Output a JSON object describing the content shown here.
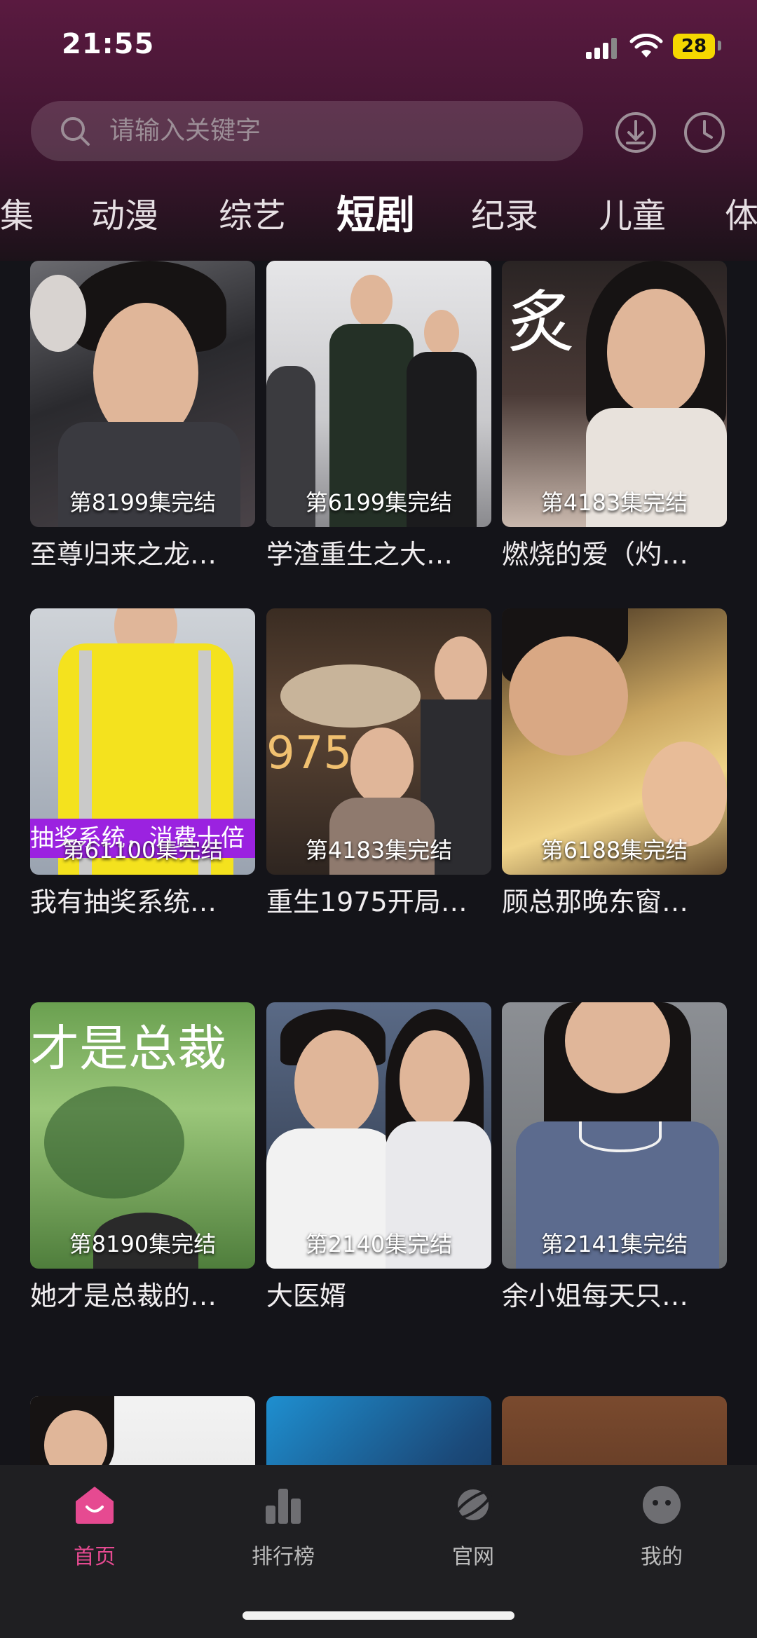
{
  "status_bar": {
    "time": "21:55",
    "battery": "28"
  },
  "search": {
    "placeholder": "请输入关键字"
  },
  "tabs": [
    {
      "label": "集"
    },
    {
      "label": "动漫"
    },
    {
      "label": "综艺"
    },
    {
      "label": "短剧",
      "active": true
    },
    {
      "label": "纪录"
    },
    {
      "label": "儿童"
    },
    {
      "label": "体"
    }
  ],
  "items": [
    {
      "episodes": "第8199集完结",
      "title": "至尊归来之龙…"
    },
    {
      "episodes": "第6199集完结",
      "title": "学渣重生之大…"
    },
    {
      "episodes": "第4183集完结",
      "title": "燃烧的爱（灼…",
      "poster_text": "炙"
    },
    {
      "episodes": "第61100集完结",
      "title": "我有抽奖系统…",
      "poster_text": "抽奖系统，消费十倍"
    },
    {
      "episodes": "第4183集完结",
      "title": "重生1975开局…",
      "poster_text": "975"
    },
    {
      "episodes": "第6188集完结",
      "title": "顾总那晚东窗…"
    },
    {
      "episodes": "第8190集完结",
      "title": "她才是总裁的…",
      "poster_text": "才是总裁"
    },
    {
      "episodes": "第2140集完结",
      "title": "大医婿"
    },
    {
      "episodes": "第2141集完结",
      "title": "余小姐每天只…"
    }
  ],
  "bottom_nav": [
    {
      "label": "首页",
      "icon": "home-icon",
      "active": true
    },
    {
      "label": "排行榜",
      "icon": "ranking-icon"
    },
    {
      "label": "官网",
      "icon": "planet-icon"
    },
    {
      "label": "我的",
      "icon": "profile-icon"
    }
  ],
  "colors": {
    "accent": "#e64a91",
    "header_gradient": "#5a1a40",
    "background": "#141419",
    "nav_background": "#1f1f22"
  }
}
